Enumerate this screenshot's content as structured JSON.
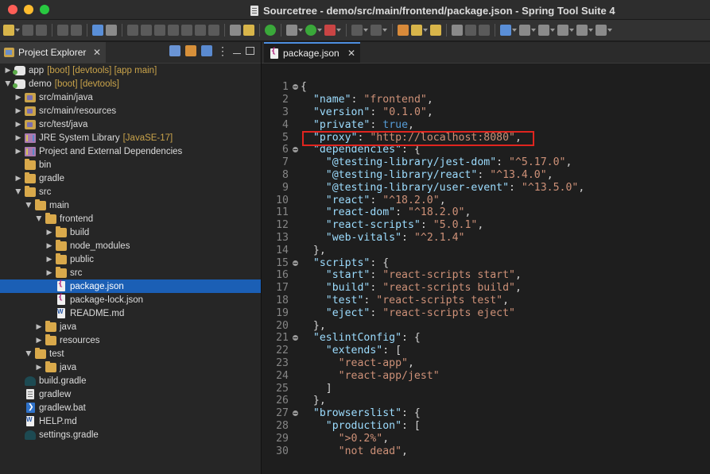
{
  "window": {
    "title": "Sourcetree - demo/src/main/frontend/package.json - Spring Tool Suite 4"
  },
  "explorer": {
    "tab_label": "Project Explorer",
    "tab_close": "✕",
    "menu_glyph": "⋮",
    "items": [
      {
        "label": "app",
        "deco": "[boot] [devtools] [app main]",
        "icon": "project-icon"
      },
      {
        "label": "demo",
        "deco": "[boot] [devtools]",
        "icon": "project-icon"
      },
      {
        "label": "src/main/java",
        "deco": "",
        "icon": "source-folder-icon"
      },
      {
        "label": "src/main/resources",
        "deco": "",
        "icon": "source-folder-icon"
      },
      {
        "label": "src/test/java",
        "deco": "",
        "icon": "source-folder-icon"
      },
      {
        "label": "JRE System Library",
        "deco": "[JavaSE-17]",
        "icon": "library-icon"
      },
      {
        "label": "Project and External Dependencies",
        "deco": "",
        "icon": "library-icon"
      },
      {
        "label": "bin",
        "deco": "",
        "icon": "folder-icon"
      },
      {
        "label": "gradle",
        "deco": "",
        "icon": "folder-icon"
      },
      {
        "label": "src",
        "deco": "",
        "icon": "folder-icon"
      },
      {
        "label": "main",
        "deco": "",
        "icon": "folder-icon"
      },
      {
        "label": "frontend",
        "deco": "",
        "icon": "folder-icon"
      },
      {
        "label": "build",
        "deco": "",
        "icon": "folder-icon"
      },
      {
        "label": "node_modules",
        "deco": "",
        "icon": "folder-icon"
      },
      {
        "label": "public",
        "deco": "",
        "icon": "folder-icon"
      },
      {
        "label": "src",
        "deco": "",
        "icon": "folder-icon"
      },
      {
        "label": "package.json",
        "deco": "",
        "icon": "json-file-icon"
      },
      {
        "label": "package-lock.json",
        "deco": "",
        "icon": "json-file-icon"
      },
      {
        "label": "README.md",
        "deco": "",
        "icon": "markdown-file-icon"
      },
      {
        "label": "java",
        "deco": "",
        "icon": "folder-icon"
      },
      {
        "label": "resources",
        "deco": "",
        "icon": "folder-icon"
      },
      {
        "label": "test",
        "deco": "",
        "icon": "folder-icon"
      },
      {
        "label": "java",
        "deco": "",
        "icon": "folder-icon"
      },
      {
        "label": "build.gradle",
        "deco": "",
        "icon": "gradle-file-icon"
      },
      {
        "label": "gradlew",
        "deco": "",
        "icon": "file-icon"
      },
      {
        "label": "gradlew.bat",
        "deco": "",
        "icon": "batch-file-icon"
      },
      {
        "label": "HELP.md",
        "deco": "",
        "icon": "markdown-file-icon"
      },
      {
        "label": "settings.gradle",
        "deco": "",
        "icon": "gradle-file-icon"
      }
    ]
  },
  "editor": {
    "tab_label": "package.json",
    "tab_close": "✕",
    "line_numbers": [
      "1",
      "2",
      "3",
      "4",
      "5",
      "6",
      "7",
      "8",
      "9",
      "10",
      "11",
      "12",
      "13",
      "14",
      "15",
      "16",
      "17",
      "18",
      "19",
      "20",
      "21",
      "22",
      "23",
      "24",
      "25",
      "26",
      "27",
      "28",
      "29",
      "30"
    ],
    "lines": [
      "{",
      "  \"name\": \"frontend\",",
      "  \"version\": \"0.1.0\",",
      "  \"private\": true,",
      "  \"proxy\": \"http://localhost:8080\",",
      "  \"dependencies\": {",
      "    \"@testing-library/jest-dom\": \"^5.17.0\",",
      "    \"@testing-library/react\": \"^13.4.0\",",
      "    \"@testing-library/user-event\": \"^13.5.0\",",
      "    \"react\": \"^18.2.0\",",
      "    \"react-dom\": \"^18.2.0\",",
      "    \"react-scripts\": \"5.0.1\",",
      "    \"web-vitals\": \"^2.1.4\"",
      "  },",
      "  \"scripts\": {",
      "    \"start\": \"react-scripts start\",",
      "    \"build\": \"react-scripts build\",",
      "    \"test\": \"react-scripts test\",",
      "    \"eject\": \"react-scripts eject\"",
      "  },",
      "  \"eslintConfig\": {",
      "    \"extends\": [",
      "      \"react-app\",",
      "      \"react-app/jest\"",
      "    ]",
      "  },",
      "  \"browserslist\": {",
      "    \"production\": [",
      "      \">0.2%\",",
      "      \"not dead\","
    ]
  },
  "colors": {
    "highlight_box": "#e0251f",
    "selection": "#1b5fb5",
    "json_key": "#9cdcfe",
    "json_string": "#ce9178",
    "json_boolean": "#569cd6"
  }
}
